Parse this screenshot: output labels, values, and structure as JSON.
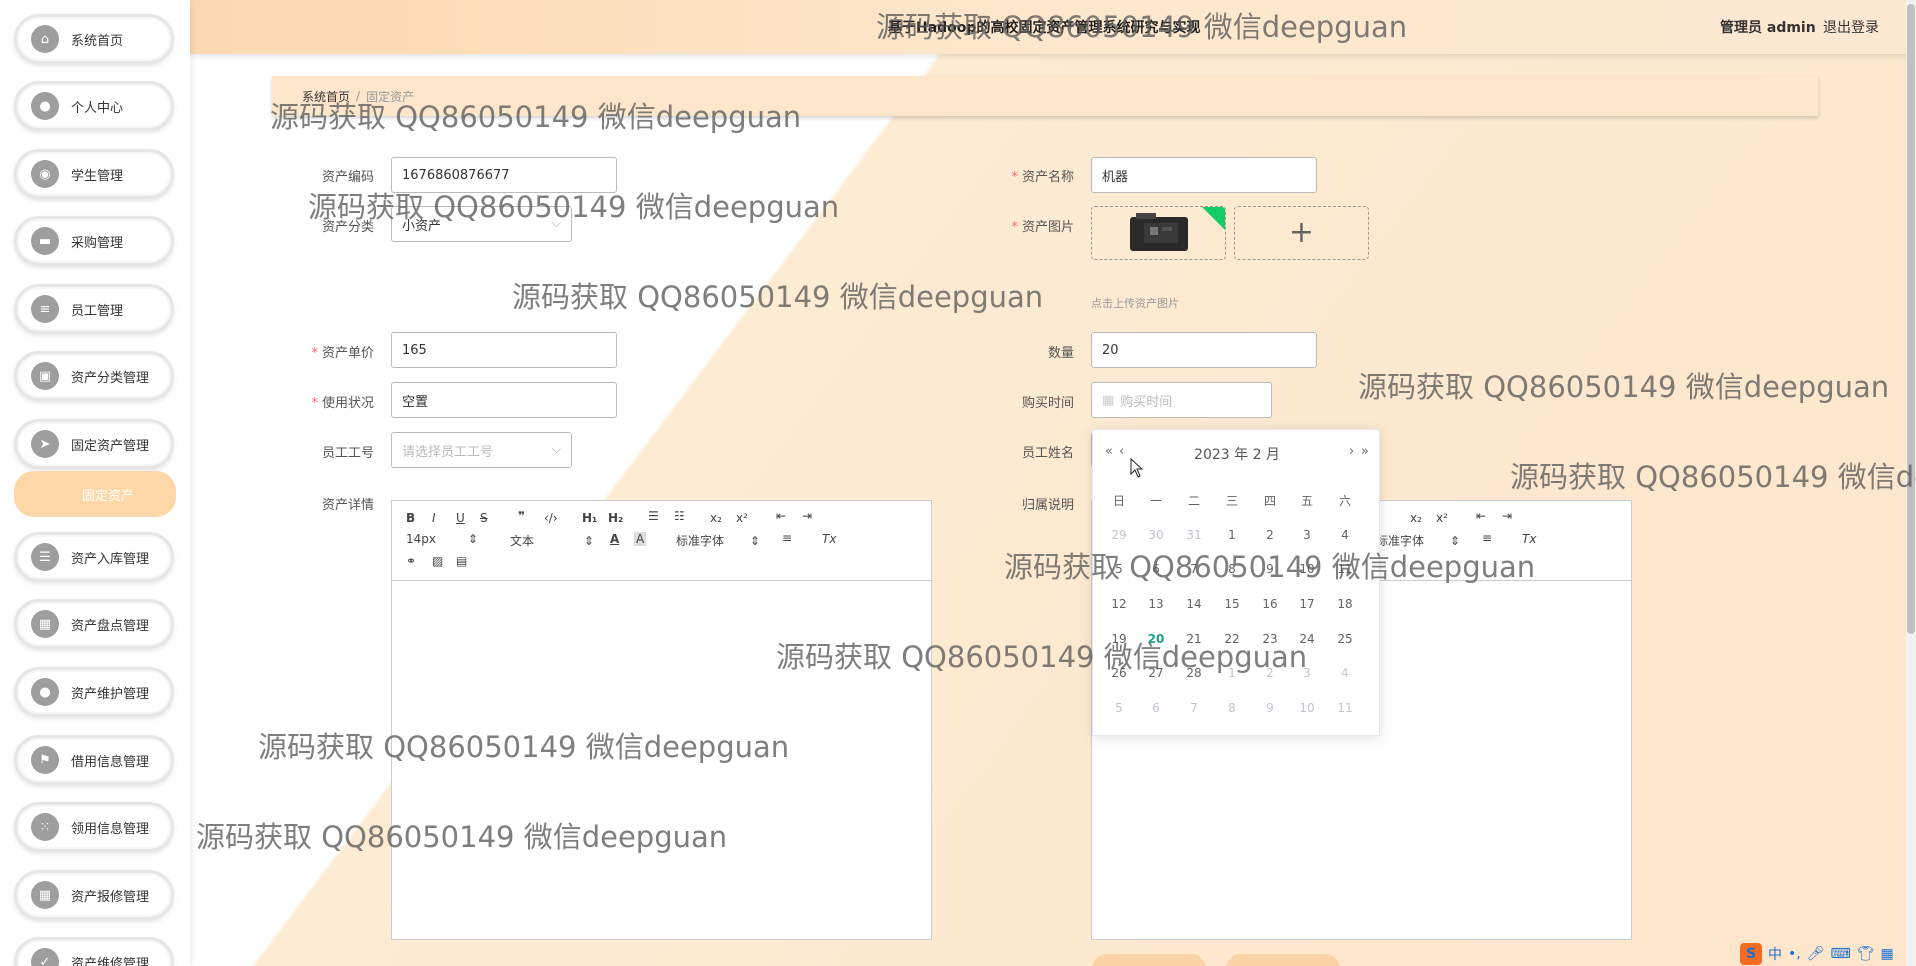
{
  "header": {
    "title": "基于Hadoop的高校固定资产管理系统研究与实现",
    "user": "管理员 admin",
    "logout": "退出登录"
  },
  "sidebar": {
    "items": [
      {
        "label": "系统首页",
        "icon": "home-icon",
        "glyph": "⌂"
      },
      {
        "label": "个人中心",
        "icon": "user-icon",
        "glyph": "●"
      },
      {
        "label": "学生管理",
        "icon": "bulb-icon",
        "glyph": "◉"
      },
      {
        "label": "采购管理",
        "icon": "briefcase-icon",
        "glyph": "▬"
      },
      {
        "label": "员工管理",
        "icon": "list-icon",
        "glyph": "≡"
      },
      {
        "label": "资产分类管理",
        "icon": "printer-icon",
        "glyph": "▣"
      },
      {
        "label": "固定资产管理",
        "icon": "send-icon",
        "glyph": "➤"
      },
      {
        "label": "资产入库管理",
        "icon": "sliders-icon",
        "glyph": "☰"
      },
      {
        "label": "资产盘点管理",
        "icon": "grid-icon",
        "glyph": "▦"
      },
      {
        "label": "资产维护管理",
        "icon": "user-icon",
        "glyph": "●"
      },
      {
        "label": "借用信息管理",
        "icon": "flag-icon",
        "glyph": "⚑"
      },
      {
        "label": "领用信息管理",
        "icon": "dots-icon",
        "glyph": "⁙"
      },
      {
        "label": "资产报修管理",
        "icon": "grid-icon",
        "glyph": "▦"
      },
      {
        "label": "资产维修管理",
        "icon": "check-icon",
        "glyph": "✓"
      }
    ],
    "submenu_active": "固定资产"
  },
  "breadcrumb": {
    "home": "系统首页",
    "separator": "/",
    "current": "固定资产"
  },
  "form": {
    "asset_code_label": "资产编码",
    "asset_code_value": "1676860876677",
    "asset_name_label": "资产名称",
    "asset_name_value": "机器",
    "category_label": "资产分类",
    "category_value": "小资产",
    "image_label": "资产图片",
    "upload_hint": "点击上传资产图片",
    "price_label": "资产单价",
    "price_value": "165",
    "quantity_label": "数量",
    "quantity_value": "20",
    "status_label": "使用状况",
    "status_value": "空置",
    "purchase_time_label": "购买时间",
    "purchase_time_placeholder": "购买时间",
    "employee_id_label": "员工工号",
    "employee_id_placeholder": "请选择员工工号",
    "employee_name_label": "员工姓名",
    "details_label": "资产详情",
    "notes_label": "归属说明"
  },
  "editor": {
    "font_size": "14px",
    "text_type": "文本",
    "font_family": "标准字体",
    "right_font_family": "标准字体"
  },
  "datepicker": {
    "title": "2023 年  2 月",
    "weekdays": [
      "日",
      "一",
      "二",
      "三",
      "四",
      "五",
      "六"
    ],
    "weeks": [
      [
        "29",
        "30",
        "31",
        "1",
        "2",
        "3",
        "4"
      ],
      [
        "5",
        "6",
        "7",
        "8",
        "9",
        "10",
        "11"
      ],
      [
        "12",
        "13",
        "14",
        "15",
        "16",
        "17",
        "18"
      ],
      [
        "19",
        "20",
        "21",
        "22",
        "23",
        "24",
        "25"
      ],
      [
        "26",
        "27",
        "28",
        "1",
        "2",
        "3",
        "4"
      ],
      [
        "5",
        "6",
        "7",
        "8",
        "9",
        "10",
        "11"
      ]
    ],
    "today": "20"
  },
  "watermark": "源码获取 QQ86050149 微信deepguan",
  "ime": {
    "lang": "中"
  }
}
